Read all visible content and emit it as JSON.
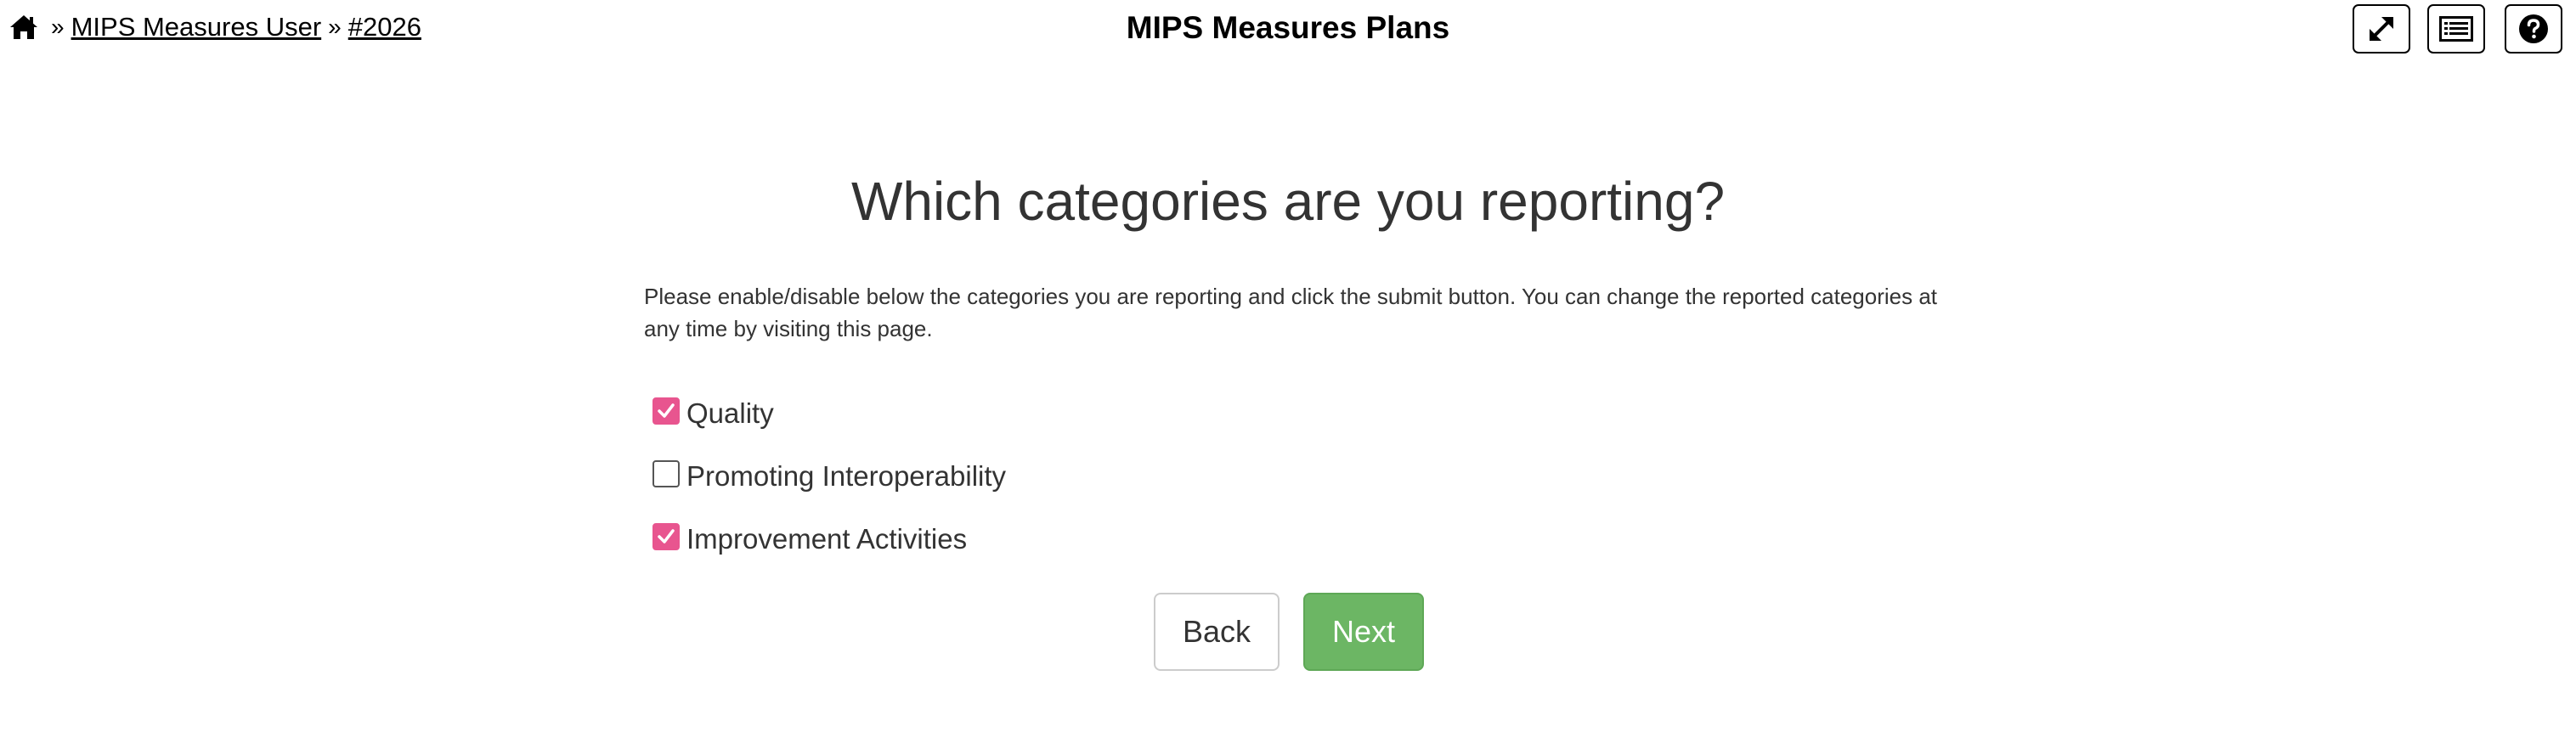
{
  "breadcrumb": {
    "home_icon": "home-icon",
    "separator": "»",
    "items": [
      "MIPS Measures User",
      "#2026"
    ]
  },
  "header": {
    "title": "MIPS Measures Plans",
    "toolbar_icons": [
      "expand-icon",
      "list-icon",
      "help-icon"
    ]
  },
  "main": {
    "heading": "Which categories are you reporting?",
    "instructions": "Please enable/disable below the categories you are reporting and click the submit button. You can change the reported categories at any time by visiting this page.",
    "categories": [
      {
        "label": "Quality",
        "checked": true
      },
      {
        "label": "Promoting Interoperability",
        "checked": false
      },
      {
        "label": "Improvement Activities",
        "checked": true
      }
    ],
    "back_label": "Back",
    "next_label": "Next"
  },
  "colors": {
    "checkbox_checked": "#e8558f",
    "next_button": "#6cb664",
    "text": "#333333"
  }
}
